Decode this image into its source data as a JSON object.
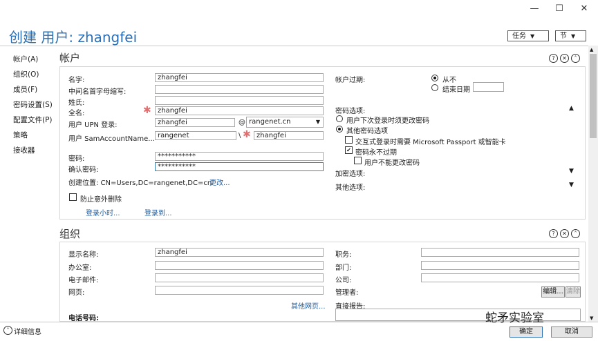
{
  "window": {
    "min": "—",
    "max": "☐",
    "close": "✕"
  },
  "header": {
    "title": "创建 用户: zhangfei",
    "task_btn": "任务",
    "section_btn": "节"
  },
  "nav": [
    "帐户(A)",
    "组织(O)",
    "成员(F)",
    "密码设置(S)",
    "配置文件(P)",
    "策略",
    "接收器"
  ],
  "account": {
    "heading": "帐户",
    "labels": {
      "first": "名字:",
      "initials": "中间名首字母缩写:",
      "last": "姓氏:",
      "full": "全名:",
      "upn": "用户 UPN 登录:",
      "sam": "用户 SamAccountName...",
      "password": "密码:",
      "confirm": "确认密码:",
      "location": "创建位置: CN=Users,DC=rangenet,DC=cn",
      "change": "更改...",
      "protect": "防止意外删除",
      "logon_hours": "登录小时...",
      "logon_to": "登录到..."
    },
    "values": {
      "first": "zhangfei",
      "initials": "",
      "last": "",
      "full": "zhangfei",
      "upn": "zhangfei",
      "upn_at": "@",
      "upn_domain": "rangenet.cn",
      "sam_domain": "rangenet",
      "sam_sep": "\\",
      "sam": "zhangfei",
      "password": "***********",
      "confirm": "***********"
    },
    "expire": {
      "label": "帐户过期:",
      "never": "从不",
      "end": "结束日期"
    },
    "pwd": {
      "label": "密码选项:",
      "opt1": "用户下次登录时须更改密码",
      "opt2": "其他密码选项",
      "sub1": "交互式登录时需要 Microsoft Passport 或智能卡",
      "sub2": "密码永不过期",
      "sub3": "用户不能更改密码"
    },
    "encrypt": "加密选项:",
    "other": "其他选项:"
  },
  "org": {
    "heading": "组织",
    "labels": {
      "display": "显示名称:",
      "office": "办公室:",
      "email": "电子邮件:",
      "web": "网页:",
      "more_web": "其他网页...",
      "phone": "电话号码:",
      "job": "职务:",
      "dept": "部门:",
      "company": "公司:",
      "manager": "管理者:",
      "edit": "编辑...",
      "clear": "清除",
      "reports": "直接报告:"
    },
    "values": {
      "display": "zhangfei"
    }
  },
  "footer": {
    "details": "详细信息",
    "ok": "确定",
    "cancel": "取消"
  },
  "watermark": "蛇矛实验室"
}
